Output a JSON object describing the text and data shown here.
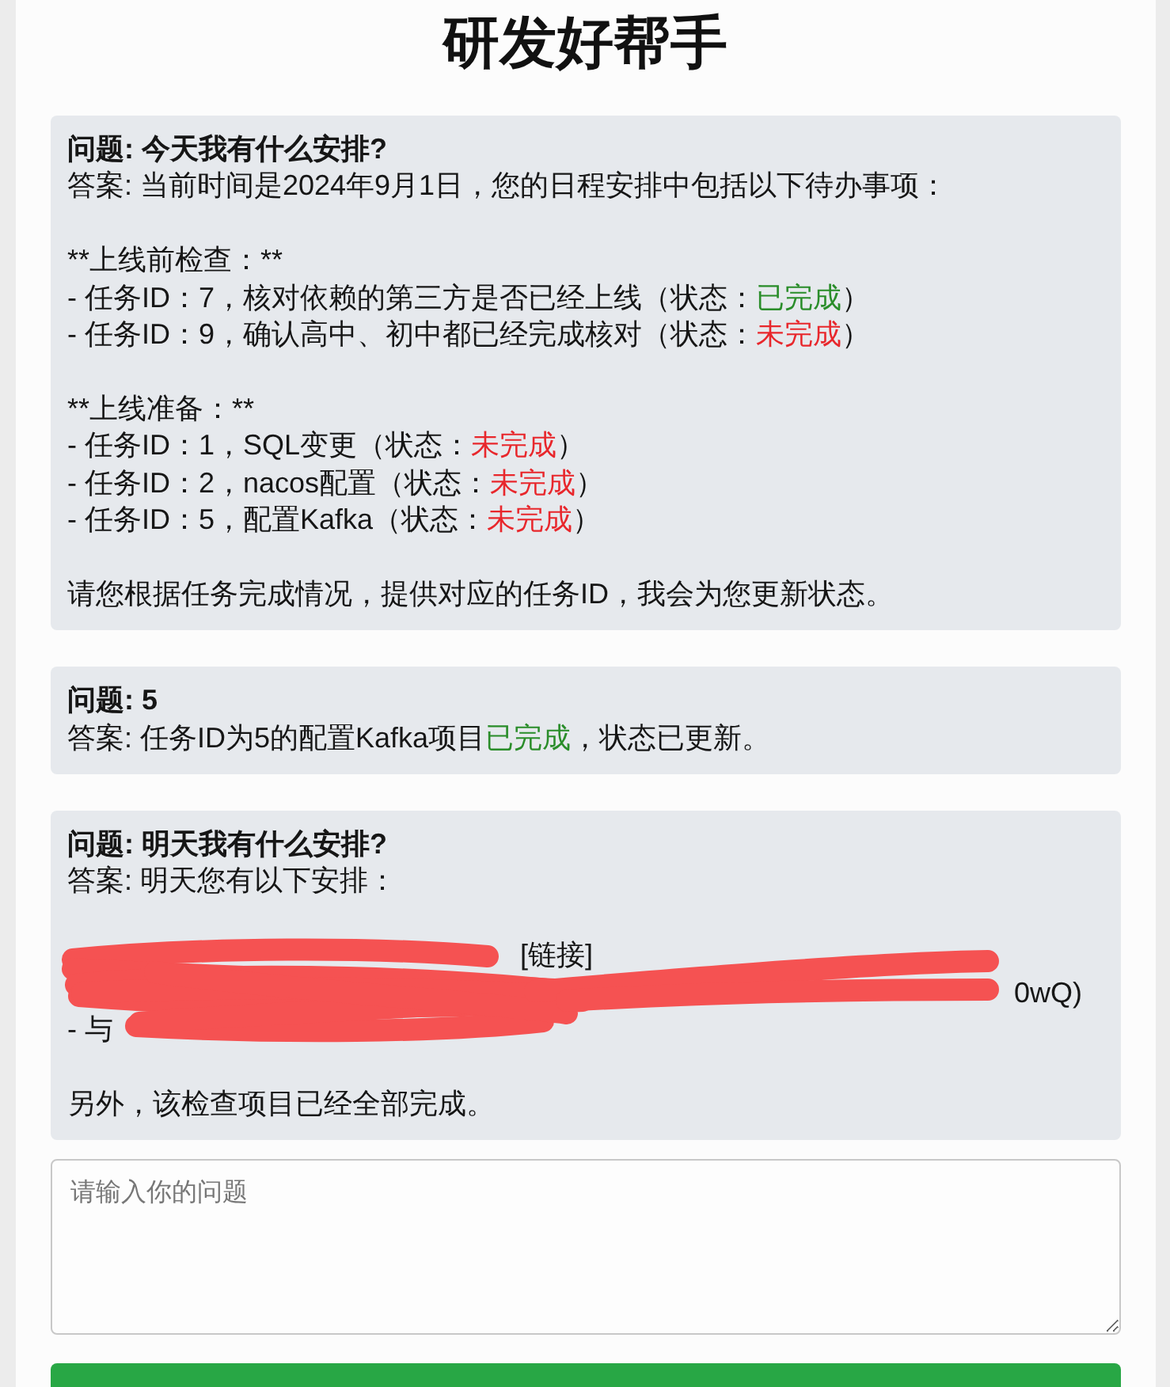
{
  "app": {
    "title": "研发好帮手"
  },
  "conversation": [
    {
      "question": "问题: 今天我有什么安排?",
      "answer": [
        {
          "kind": "text",
          "lines": [
            {
              "segments": [
                {
                  "kind": "plain",
                  "text": "答案: 当前时间是2024年9月1日，您的日程安排中包括以下待办事项："
                }
              ]
            }
          ]
        },
        {
          "kind": "text",
          "lines": [
            {
              "segments": [
                {
                  "kind": "plain",
                  "text": "**上线前检查：**"
                }
              ]
            },
            {
              "segments": [
                {
                  "kind": "plain",
                  "text": "- 任务ID：7，核对依赖的第三方是否已经上线（状态："
                },
                {
                  "kind": "done",
                  "text": "已完成"
                },
                {
                  "kind": "plain",
                  "text": "）"
                }
              ]
            },
            {
              "segments": [
                {
                  "kind": "plain",
                  "text": "- 任务ID：9，确认高中、初中都已经完成核对（状态："
                },
                {
                  "kind": "pending",
                  "text": "未完成"
                },
                {
                  "kind": "plain",
                  "text": "）"
                }
              ]
            }
          ]
        },
        {
          "kind": "text",
          "lines": [
            {
              "segments": [
                {
                  "kind": "plain",
                  "text": "**上线准备：**"
                }
              ]
            },
            {
              "segments": [
                {
                  "kind": "plain",
                  "text": "- 任务ID：1，SQL变更（状态："
                },
                {
                  "kind": "pending",
                  "text": "未完成"
                },
                {
                  "kind": "plain",
                  "text": "）"
                }
              ]
            },
            {
              "segments": [
                {
                  "kind": "plain",
                  "text": "- 任务ID：2，nacos配置（状态："
                },
                {
                  "kind": "pending",
                  "text": "未完成"
                },
                {
                  "kind": "plain",
                  "text": "）"
                }
              ]
            },
            {
              "segments": [
                {
                  "kind": "plain",
                  "text": "- 任务ID：5，配置Kafka（状态："
                },
                {
                  "kind": "pending",
                  "text": "未完成"
                },
                {
                  "kind": "plain",
                  "text": "）"
                }
              ]
            }
          ]
        },
        {
          "kind": "text",
          "lines": [
            {
              "segments": [
                {
                  "kind": "plain",
                  "text": "请您根据任务完成情况，提供对应的任务ID，我会为您更新状态。"
                }
              ]
            }
          ]
        }
      ]
    },
    {
      "question": "问题: 5",
      "answer": [
        {
          "kind": "text",
          "lines": [
            {
              "segments": [
                {
                  "kind": "plain",
                  "text": "答案: 任务ID为5的配置Kafka项目"
                },
                {
                  "kind": "done",
                  "text": "已完成"
                },
                {
                  "kind": "plain",
                  "text": "，状态已更新。"
                }
              ]
            }
          ]
        }
      ]
    },
    {
      "question": "问题: 明天我有什么安排?",
      "answer": [
        {
          "kind": "text",
          "lines": [
            {
              "segments": [
                {
                  "kind": "plain",
                  "text": "答案: 明天您有以下安排："
                }
              ]
            }
          ]
        },
        {
          "kind": "redacted",
          "lines": [
            {
              "text": "[链接]"
            },
            {
              "text": "0wQ)"
            },
            {
              "text": "- 与"
            }
          ]
        },
        {
          "kind": "text",
          "lines": [
            {
              "segments": [
                {
                  "kind": "plain",
                  "text": "另外，该检查项目已经全部完成。"
                }
              ]
            }
          ]
        }
      ]
    }
  ],
  "input": {
    "placeholder": "请输入你的问题"
  }
}
